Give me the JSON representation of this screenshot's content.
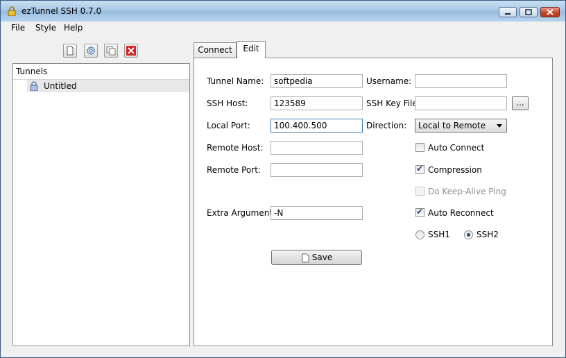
{
  "window": {
    "title": "ezTunnel SSH 0.7.0"
  },
  "menu": {
    "file": "File",
    "style": "Style",
    "help": "Help"
  },
  "toolbar": {
    "new_icon": "new-document-icon",
    "settings_icon": "gear-icon",
    "copy_icon": "copy-icon",
    "delete_icon": "delete-icon"
  },
  "tree": {
    "header": "Tunnels",
    "items": [
      {
        "label": "Untitled",
        "icon": "lock-icon"
      }
    ]
  },
  "tabs": {
    "connect": "Connect",
    "edit": "Edit",
    "active": "Edit"
  },
  "form": {
    "tunnel_name_label": "Tunnel Name:",
    "tunnel_name_value": "softpedia",
    "ssh_host_label": "SSH Host:",
    "ssh_host_value": "123589",
    "local_port_label": "Local Port:",
    "local_port_value": "100.400.500",
    "remote_host_label": "Remote Host:",
    "remote_host_value": "",
    "remote_port_label": "Remote Port:",
    "remote_port_value": "",
    "extra_args_label": "Extra Arguments:",
    "extra_args_value": "-N",
    "username_label": "Username:",
    "username_value": "",
    "ssh_key_file_label": "SSH Key File:",
    "ssh_key_file_value": "",
    "browse_label": "...",
    "direction_label": "Direction:",
    "direction_value": "Local to Remote",
    "auto_connect_label": "Auto Connect",
    "compression_label": "Compression",
    "keepalive_label": "Do Keep-Alive Ping",
    "auto_reconnect_label": "Auto Reconnect",
    "ssh1_label": "SSH1",
    "ssh2_label": "SSH2",
    "save_label": "Save"
  },
  "state": {
    "auto_connect": false,
    "compression": true,
    "keepalive": false,
    "keepalive_enabled": false,
    "auto_reconnect": true,
    "protocol": "SSH2"
  }
}
